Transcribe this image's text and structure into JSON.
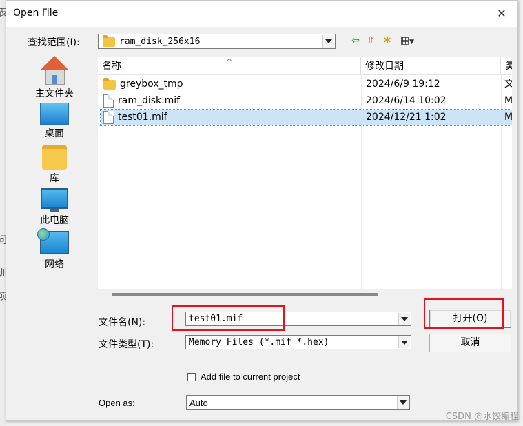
{
  "window": {
    "title": "Open File",
    "close_glyph": "✕"
  },
  "background": {
    "fragments": [
      "表",
      "问",
      "训",
      "项"
    ]
  },
  "lookin": {
    "label": "查找范围(I):",
    "value": "ram_disk_256x16"
  },
  "toolbar": {
    "back_glyph": "⇦",
    "up_glyph": "⇧",
    "newfolder_glyph": "✱",
    "view_glyph": "▦"
  },
  "places": [
    {
      "label": "主文件夹",
      "icon": "home-icon"
    },
    {
      "label": "桌面",
      "icon": "desktop-icon"
    },
    {
      "label": "库",
      "icon": "library-icon"
    },
    {
      "label": "此电脑",
      "icon": "computer-icon"
    },
    {
      "label": "网络",
      "icon": "network-icon"
    }
  ],
  "columns": {
    "name": "名称",
    "date": "修改日期",
    "type": "类"
  },
  "sort_caret": "^",
  "files": [
    {
      "name": "greybox_tmp",
      "date": "2024/6/9 19:12",
      "type": "文",
      "kind": "folder"
    },
    {
      "name": "ram_disk.mif",
      "date": "2024/6/14 10:02",
      "type": "M",
      "kind": "file"
    },
    {
      "name": "test01.mif",
      "date": "2024/12/21 1:02",
      "type": "M",
      "kind": "file",
      "selected": true
    }
  ],
  "filename": {
    "label": "文件名(N):",
    "value": "test01.mif"
  },
  "filetype": {
    "label": "文件类型(T):",
    "value": "Memory Files (*.mif *.hex)"
  },
  "buttons": {
    "open": "打开(O)",
    "cancel": "取消"
  },
  "add_to_project": {
    "label": "Add file to current project",
    "checked": false
  },
  "open_as": {
    "label": "Open as:",
    "value": "Auto"
  },
  "watermark": "CSDN @水饺编程"
}
